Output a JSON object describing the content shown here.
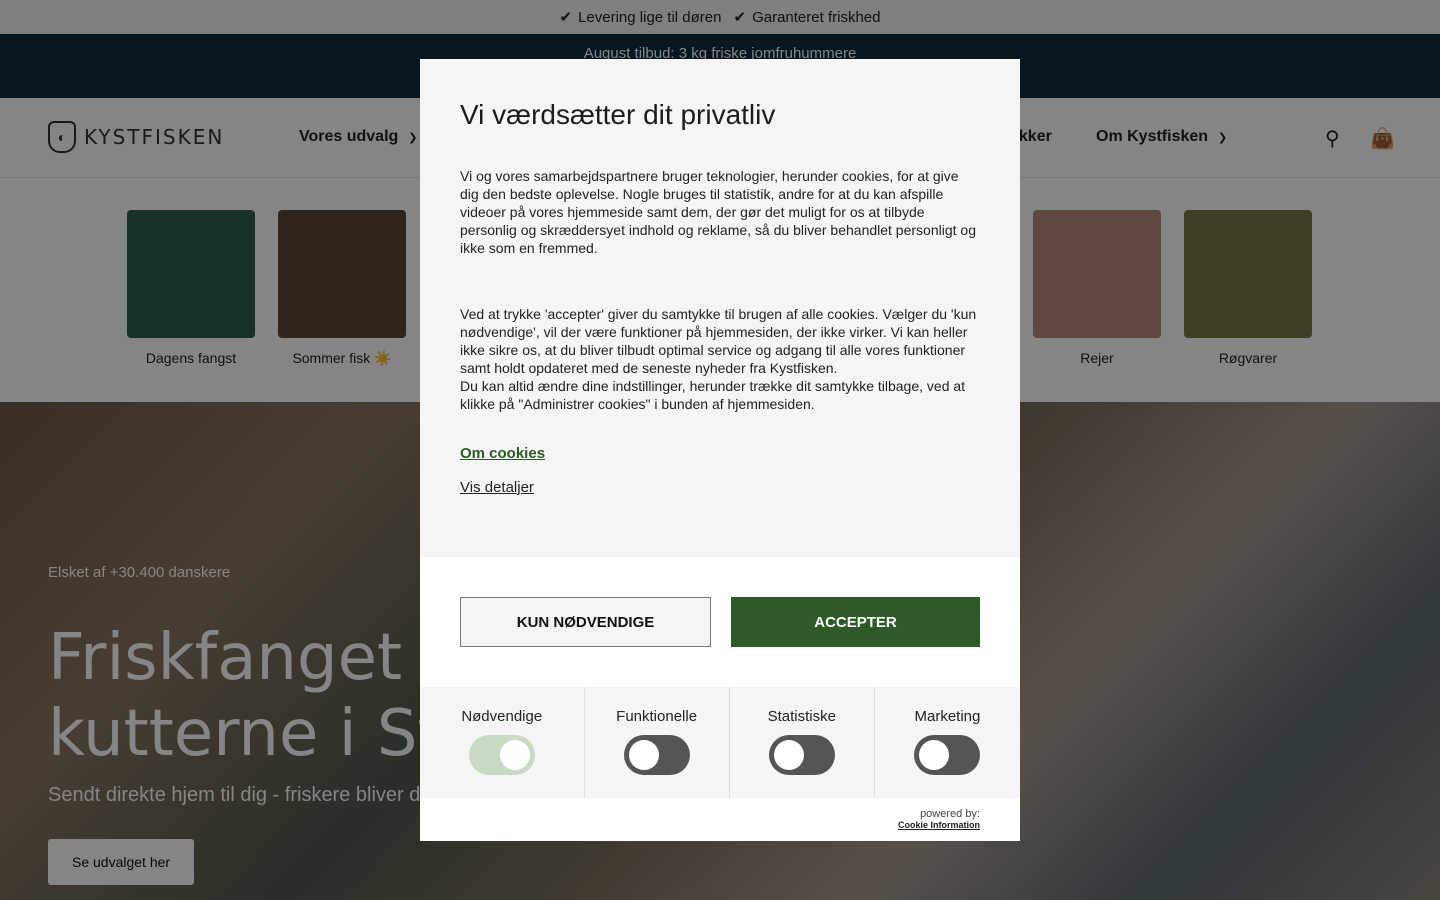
{
  "topbar": {
    "items": [
      "Levering lige til døren",
      "Garanteret friskhed"
    ]
  },
  "promo": {
    "text": "August tilbud: 3 kg friske jomfruhummere"
  },
  "header": {
    "logo_text": "KYSTFISKEN",
    "nav": [
      "Vores udvalg",
      "akker",
      "Om Kystfisken"
    ]
  },
  "categories": [
    {
      "label": "Dagens fangst",
      "color": "#2e5e4a"
    },
    {
      "label": "Sommer fisk ☀️",
      "color": "#5a4535"
    },
    {
      "label": "Rejer",
      "color": "#b48a7a"
    },
    {
      "label": "Røgvarer",
      "color": "#7a7a4a"
    }
  ],
  "hero": {
    "loved": "Elsket af +30.400 danskere",
    "title_line1": "Friskfanget fi",
    "title_line2": "kutterne i Str",
    "subtitle": "Sendt direkte hjem til dig - friskere bliver d",
    "cta": "Se udvalget her"
  },
  "modal": {
    "title": "Vi værdsætter dit privatliv",
    "paragraph1": "Vi og vores samarbejdspartnere bruger teknologier, herunder cookies, for at give dig den bedste oplevelse. Nogle bruges til statistik, andre for at du kan afspille videoer på vores hjemmeside samt dem, der gør det muligt for os at tilbyde personlig og skræddersyet indhold og reklame, så du bliver behandlet personligt og ikke som en fremmed.",
    "paragraph2": "Ved at trykke 'accepter' giver du samtykke til brugen af alle cookies. Vælger du 'kun nødvendige', vil der være funktioner på hjemmesiden, der ikke virker. Vi kan heller ikke sikre os, at du bliver tilbudt optimal service og adgang til alle vores funktioner samt holdt opdateret med de seneste nyheder fra Kystfisken.",
    "paragraph3": "Du kan altid ændre dine indstillinger, herunder trække dit samtykke tilbage, ved at klikke på \"Administrer cookies\" i bunden af hjemmesiden.",
    "link_about": "Om cookies",
    "link_details": "Vis detaljer",
    "btn_necessary": "KUN NØDVENDIGE",
    "btn_accept": "ACCEPTER",
    "toggles": [
      {
        "label": "Nødvendige",
        "on": true
      },
      {
        "label": "Funktionelle",
        "on": false
      },
      {
        "label": "Statistiske",
        "on": false
      },
      {
        "label": "Marketing",
        "on": false
      }
    ],
    "powered_by": "powered by:",
    "provider": "Cookie Information"
  },
  "colors": {
    "accept": "#2d5a27",
    "promo_bg": "#0f2b3d",
    "overlay": "rgba(0,0,0,0.48)"
  }
}
